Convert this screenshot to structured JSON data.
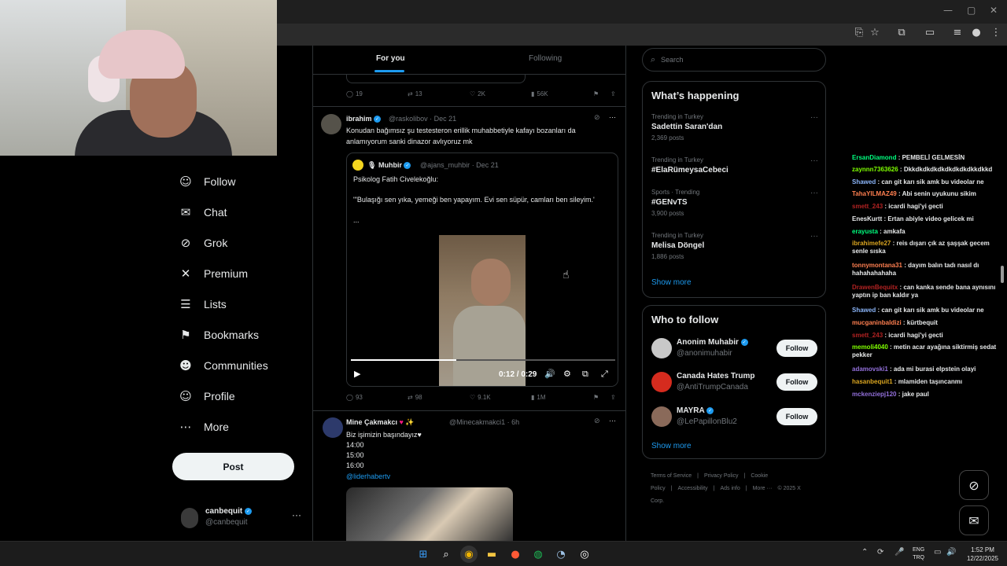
{
  "browser": {
    "window_controls": [
      "—",
      "▢",
      "✕"
    ],
    "toolbar_icons": [
      "cast-icon",
      "star-icon",
      "extensions-icon",
      "sidepanel-icon",
      "media-icon",
      "profile-icon",
      "menu-icon"
    ]
  },
  "nav": {
    "items": [
      {
        "label": "Follow",
        "icon": "follow-icon",
        "glyph": "☺"
      },
      {
        "label": "Chat",
        "icon": "chat-icon",
        "glyph": "✉"
      },
      {
        "label": "Grok",
        "icon": "grok-icon",
        "glyph": "⊘"
      },
      {
        "label": "Premium",
        "icon": "x-icon",
        "glyph": "✕"
      },
      {
        "label": "Lists",
        "icon": "lists-icon",
        "glyph": "☰"
      },
      {
        "label": "Bookmarks",
        "icon": "bookmark-icon",
        "glyph": "⚑"
      },
      {
        "label": "Communities",
        "icon": "communities-icon",
        "glyph": "☻"
      },
      {
        "label": "Profile",
        "icon": "profile-icon",
        "glyph": "☺"
      },
      {
        "label": "More",
        "icon": "more-icon",
        "glyph": "⋯"
      }
    ],
    "post_label": "Post",
    "account": {
      "name": "canbequit",
      "handle": "@canbequit",
      "more": "···"
    }
  },
  "timeline": {
    "tabs": [
      "For you",
      "Following"
    ],
    "prev_actions": {
      "replies": "19",
      "reposts": "13",
      "likes": "2K",
      "views": "56K"
    },
    "tweet1": {
      "name": "ibrahim",
      "handle": "@raskolibov",
      "date": "· Dec 21",
      "text": "Konudan bağımsız şu testesteron erillik muhabbetiyle kafayı bozanları da anlamıyorum sanki dinazor avlıyoruz mk",
      "quote": {
        "name": "Muhbir",
        "handle": "@ajans_muhbir",
        "date": "· Dec 21",
        "line1": "Psikolog Fatih Civelekoğlu:",
        "line2": "\"'Bulaşığı sen yıka, yemeği ben yapayım. Evi sen süpür, camları ben sileyim.'",
        "line3": "...",
        "video_time": "0:12 / 0:29"
      },
      "actions": {
        "replies": "93",
        "reposts": "98",
        "likes": "9.1K",
        "views": "1M"
      }
    },
    "tweet2": {
      "name": "Mine Çakmakcı",
      "emoji": "♥ ✨",
      "handle": "@Minecakmakci1",
      "date": "· 6h",
      "lines": [
        "Biz işimizin başındayız♥",
        "14:00",
        "15:00",
        "16:00"
      ],
      "link": "@liderhabertv"
    }
  },
  "right": {
    "search_placeholder": "Search",
    "happening_title": "What’s happening",
    "trends": [
      {
        "context": "Trending in Turkey",
        "title": "Sadettin Saran'dan",
        "count": "2,369 posts"
      },
      {
        "context": "Trending in Turkey",
        "title": "#ElaRümeysaCebeci",
        "count": ""
      },
      {
        "context": "Sports · Trending",
        "title": "#GENvTS",
        "count": "3,900 posts"
      },
      {
        "context": "Trending in Turkey",
        "title": "Melisa Döngel",
        "count": "1,886 posts"
      }
    ],
    "show_more": "Show more",
    "wtf_title": "Who to follow",
    "wtf": [
      {
        "name": "Anonim Muhabir",
        "handle": "@anonimuhabir",
        "follow": "Follow",
        "avatar_color": "#c8c8c8",
        "verified": true
      },
      {
        "name": "Canada Hates Trump",
        "handle": "@AntiTrumpCanada",
        "follow": "Follow",
        "avatar_color": "#d52b1e",
        "verified": false
      },
      {
        "name": "MAYRA",
        "handle": "@LePapillonBlu2",
        "follow": "Follow",
        "avatar_color": "#8a6a5a",
        "verified": true
      }
    ],
    "footer": [
      "Terms of Service",
      "|",
      "Privacy Policy",
      "|",
      "Cookie Policy",
      "|",
      "Accessibility",
      "|",
      "Ads info",
      "|",
      "More ···",
      "© 2025 X Corp."
    ]
  },
  "chat": [
    {
      "user": "ErsanDiamond",
      "color": "#00ff7f",
      "msg": "PEMBELİ GELMESİN"
    },
    {
      "user": "zaynnn7363626",
      "color": "#7fff00",
      "msg": "Dkkdkdkdkdkdkdkdkdkkdkkd"
    },
    {
      "user": "Shawed",
      "color": "#8ab4f8",
      "msg": "can git karı sik amk bu videolar ne"
    },
    {
      "user": "TahaYILMAZ49",
      "color": "#ff7f50",
      "msg": "Abi senin uyukunu sikim"
    },
    {
      "user": "smett_243",
      "color": "#b22222",
      "msg": "icardi hagi'yi gecti"
    },
    {
      "user": "EnesKurtt",
      "color": "#e7e9ea",
      "msg": "Ertan abiyle video gelicek mi"
    },
    {
      "user": "erayusta",
      "color": "#00ff7f",
      "msg": "amkafa"
    },
    {
      "user": "ibrahimefe27",
      "color": "#daa520",
      "msg": "reis dışarı çık az şaşşak gecem senle sıska"
    },
    {
      "user": "tonnymontana31",
      "color": "#ff7f50",
      "msg": "dayım balın tadı nasıl dı hahahahahaha"
    },
    {
      "user": "DrawenBequitx",
      "color": "#b22222",
      "msg": "can kanka sende bana aynısını yaptın ip ban kaldır ya"
    },
    {
      "user": "Shawed",
      "color": "#8ab4f8",
      "msg": "can git karı sik amk bu videolar ne"
    },
    {
      "user": "mucganinbaldizi",
      "color": "#ff7f50",
      "msg": "kürtbequit"
    },
    {
      "user": "smett_243",
      "color": "#b22222",
      "msg": "icardi hagi'yi gecti"
    },
    {
      "user": "memoli4040",
      "color": "#7fff00",
      "msg": "metin acar ayağına siktirmiş sedat pekker"
    },
    {
      "user": "adamovski1",
      "color": "#9370db",
      "msg": "ada mi burasi elpstein olayi"
    },
    {
      "user": "hasanbequit1",
      "color": "#daa520",
      "msg": "mlamiden taşıncanmı"
    },
    {
      "user": "mckenziepj120",
      "color": "#9370db",
      "msg": "jake paul"
    }
  ],
  "taskbar": {
    "lang": "ENG",
    "region": "TRQ",
    "time": "1:52 PM",
    "date": "12/22/2025"
  }
}
